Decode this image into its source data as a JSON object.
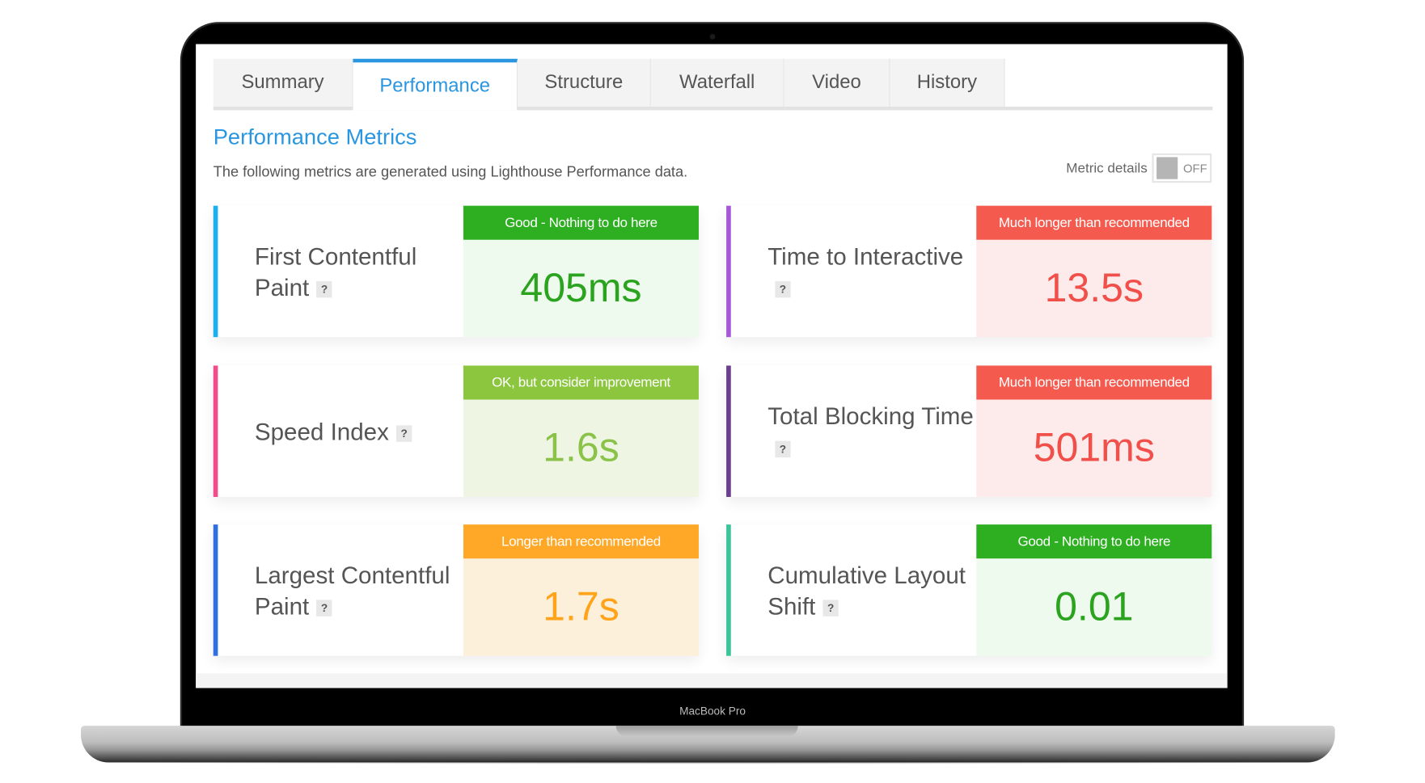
{
  "device_label": "MacBook Pro",
  "tabs": [
    {
      "label": "Summary",
      "active": false
    },
    {
      "label": "Performance",
      "active": true
    },
    {
      "label": "Structure",
      "active": false
    },
    {
      "label": "Waterfall",
      "active": false
    },
    {
      "label": "Video",
      "active": false
    },
    {
      "label": "History",
      "active": false
    }
  ],
  "section": {
    "title": "Performance Metrics",
    "description": "The following metrics are generated using Lighthouse Performance data.",
    "metric_details_label": "Metric details",
    "metric_details_state": "OFF"
  },
  "help_icon": "?",
  "metrics": [
    {
      "name": "First Contentful Paint",
      "status": "Good - Nothing to do here",
      "value": "405ms",
      "accent": "#1ab0f0",
      "status_color": "#2eaf22",
      "bg": "#effaee",
      "value_color": "#2aa31e"
    },
    {
      "name": "Time to Interactive",
      "status": "Much longer than recommended",
      "value": "13.5s",
      "accent": "#a45ad8",
      "status_color": "#f55a4e",
      "bg": "#fdeaea",
      "value_color": "#f1504a"
    },
    {
      "name": "Speed Index",
      "status": "OK, but consider improvement",
      "value": "1.6s",
      "accent": "#ef4d8c",
      "status_color": "#8cc63f",
      "bg": "#eef6e3",
      "value_color": "#8bc34a"
    },
    {
      "name": "Total Blocking Time",
      "status": "Much longer than recommended",
      "value": "501ms",
      "accent": "#6b3f8e",
      "status_color": "#f55a4e",
      "bg": "#fdeaea",
      "value_color": "#f1504a"
    },
    {
      "name": "Largest Contentful Paint",
      "status": "Longer than recommended",
      "value": "1.7s",
      "accent": "#2f6fe0",
      "status_color": "#ffa726",
      "bg": "#fdf0da",
      "value_color": "#ffa31a"
    },
    {
      "name": "Cumulative Layout Shift",
      "status": "Good - Nothing to do here",
      "value": "0.01",
      "accent": "#3cc49a",
      "status_color": "#2eaf22",
      "bg": "#effaee",
      "value_color": "#2aa31e"
    }
  ]
}
